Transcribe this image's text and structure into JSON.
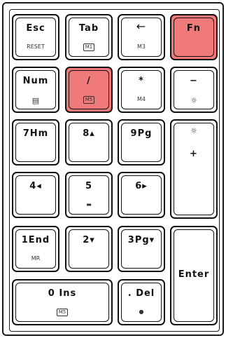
{
  "keyboard": {
    "keys": [
      {
        "id": "esc",
        "main": "Esc",
        "sub": "RESET"
      },
      {
        "id": "tab",
        "main": "Tab",
        "sub": "M1"
      },
      {
        "id": "backspace",
        "main": "←",
        "sub": "M3"
      },
      {
        "id": "fn",
        "main": "Fn",
        "sub": ""
      },
      {
        "id": "num",
        "main": "Num",
        "sub": "▤"
      },
      {
        "id": "slash",
        "main": "/",
        "sub": "M5"
      },
      {
        "id": "asterisk",
        "main": "*",
        "sub": "M4"
      },
      {
        "id": "minus",
        "main": "−",
        "sub": "☼"
      },
      {
        "id": "seven",
        "main": "7Hm",
        "sub": ""
      },
      {
        "id": "eight",
        "main": "8▴",
        "sub": ""
      },
      {
        "id": "nine",
        "main": "9Pg",
        "sub": ""
      },
      {
        "id": "plus",
        "main": "+",
        "sub": "☼"
      },
      {
        "id": "four",
        "main": "4◂",
        "sub": ""
      },
      {
        "id": "five",
        "main": "5",
        "sub": "▬"
      },
      {
        "id": "six",
        "main": "6▸",
        "sub": ""
      },
      {
        "id": "one",
        "main": "1End",
        "sub": "MR"
      },
      {
        "id": "two",
        "main": "2▾",
        "sub": ""
      },
      {
        "id": "three",
        "main": "3Pg▾",
        "sub": ""
      },
      {
        "id": "enter",
        "main": "Enter",
        "sub": ""
      },
      {
        "id": "zero",
        "main": "0 Ins",
        "sub": "M5"
      },
      {
        "id": "del",
        "main": ". Del",
        "sub": "●"
      }
    ],
    "accent_color": "#f07a7a"
  }
}
